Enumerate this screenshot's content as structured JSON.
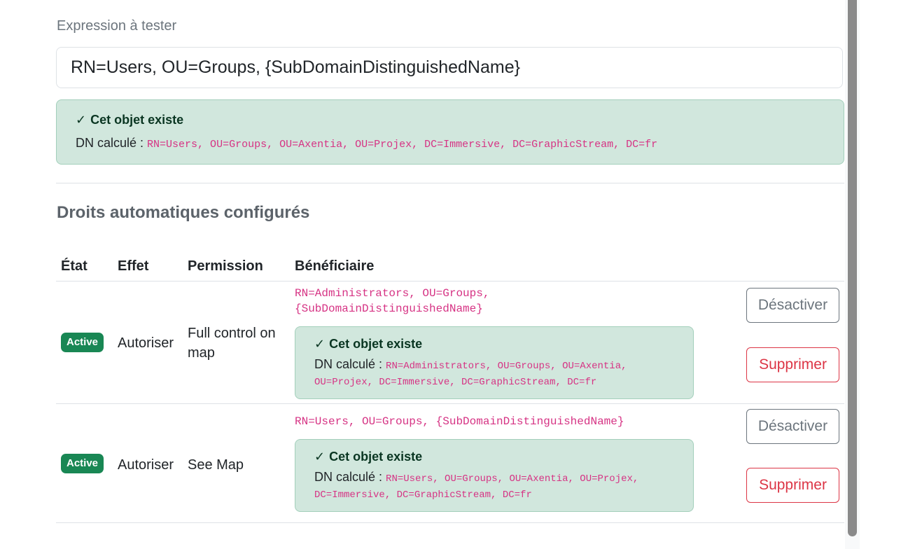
{
  "expression": {
    "label": "Expression à tester",
    "value": "RN=Users, OU=Groups, {SubDomainDistinguishedName}",
    "result": {
      "check_icon": "✓",
      "title": "Cet objet existe",
      "dn_label": "DN calculé :",
      "dn_value": "RN=Users, OU=Groups, OU=Axentia, OU=Projex, DC=Immersive, DC=GraphicStream, DC=fr"
    }
  },
  "rights": {
    "title": "Droits automatiques configurés",
    "headers": {
      "state": "État",
      "effect": "Effet",
      "permission": "Permission",
      "beneficiary": "Bénéficiaire"
    },
    "rows": [
      {
        "state": "Active",
        "effect": "Autoriser",
        "permission": "Full control on map",
        "beneficiary_line1": "RN=Administrators, OU=Groups,",
        "beneficiary_line2": "{SubDomainDistinguishedName}",
        "check_icon": "✓",
        "check_title": "Cet objet existe",
        "dn_label": "DN calculé :",
        "dn_line1": "RN=Administrators, OU=Groups, OU=Axentia,",
        "dn_line2": "OU=Projex, DC=Immersive, DC=GraphicStream, DC=fr",
        "deactivate_label": "Désactiver",
        "delete_label": "Supprimer"
      },
      {
        "state": "Active",
        "effect": "Autoriser",
        "permission": "See Map",
        "beneficiary_line1": "RN=Users, OU=Groups, {SubDomainDistinguishedName}",
        "check_icon": "✓",
        "check_title": "Cet objet existe",
        "dn_label": "DN calculé :",
        "dn_line1": "RN=Users, OU=Groups, OU=Axentia, OU=Projex,",
        "dn_line2": "DC=Immersive, DC=GraphicStream, DC=fr",
        "deactivate_label": "Désactiver",
        "delete_label": "Supprimer"
      }
    ]
  },
  "colors": {
    "success_bg": "#d1e7dd",
    "success_badge": "#198754",
    "code_pink": "#d63384",
    "danger": "#dc3545",
    "secondary": "#6c757d"
  }
}
